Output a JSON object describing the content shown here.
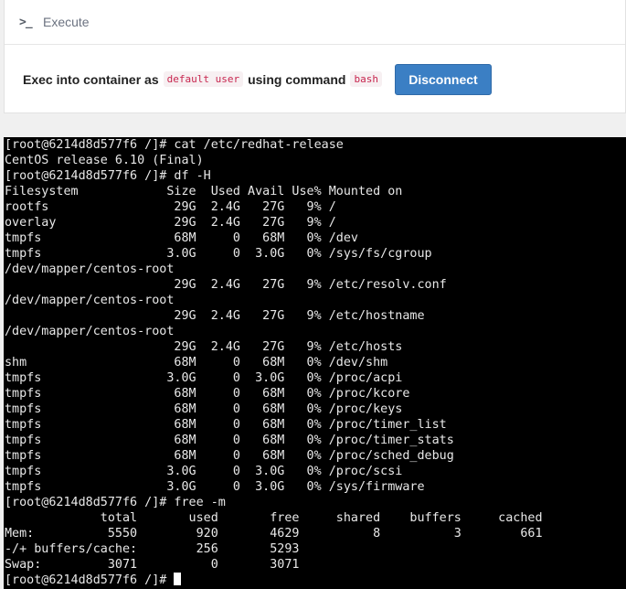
{
  "header": {
    "icon": "terminal-prompt-icon",
    "icon_glyph": ">_",
    "title": "Execute"
  },
  "exec_bar": {
    "prefix": "Exec into container as",
    "user_chip": "default user",
    "middle": "using command",
    "command_chip": "bash",
    "disconnect_label": "Disconnect"
  },
  "terminal": {
    "lines": [
      "[root@6214d8d577f6 /]# cat /etc/redhat-release",
      "CentOS release 6.10 (Final)",
      "[root@6214d8d577f6 /]# df -H",
      "Filesystem            Size  Used Avail Use% Mounted on",
      "rootfs                 29G  2.4G   27G   9% /",
      "overlay                29G  2.4G   27G   9% /",
      "tmpfs                  68M     0   68M   0% /dev",
      "tmpfs                 3.0G     0  3.0G   0% /sys/fs/cgroup",
      "/dev/mapper/centos-root",
      "                       29G  2.4G   27G   9% /etc/resolv.conf",
      "/dev/mapper/centos-root",
      "                       29G  2.4G   27G   9% /etc/hostname",
      "/dev/mapper/centos-root",
      "                       29G  2.4G   27G   9% /etc/hosts",
      "shm                    68M     0   68M   0% /dev/shm",
      "tmpfs                 3.0G     0  3.0G   0% /proc/acpi",
      "tmpfs                  68M     0   68M   0% /proc/kcore",
      "tmpfs                  68M     0   68M   0% /proc/keys",
      "tmpfs                  68M     0   68M   0% /proc/timer_list",
      "tmpfs                  68M     0   68M   0% /proc/timer_stats",
      "tmpfs                  68M     0   68M   0% /proc/sched_debug",
      "tmpfs                 3.0G     0  3.0G   0% /proc/scsi",
      "tmpfs                 3.0G     0  3.0G   0% /sys/firmware",
      "[root@6214d8d577f6 /]# free -m",
      "             total       used       free     shared    buffers     cached",
      "Mem:          5550        920       4629          8          3        661",
      "-/+ buffers/cache:        256       5293",
      "Swap:         3071          0       3071"
    ],
    "prompt": "[root@6214d8d577f6 /]# "
  }
}
